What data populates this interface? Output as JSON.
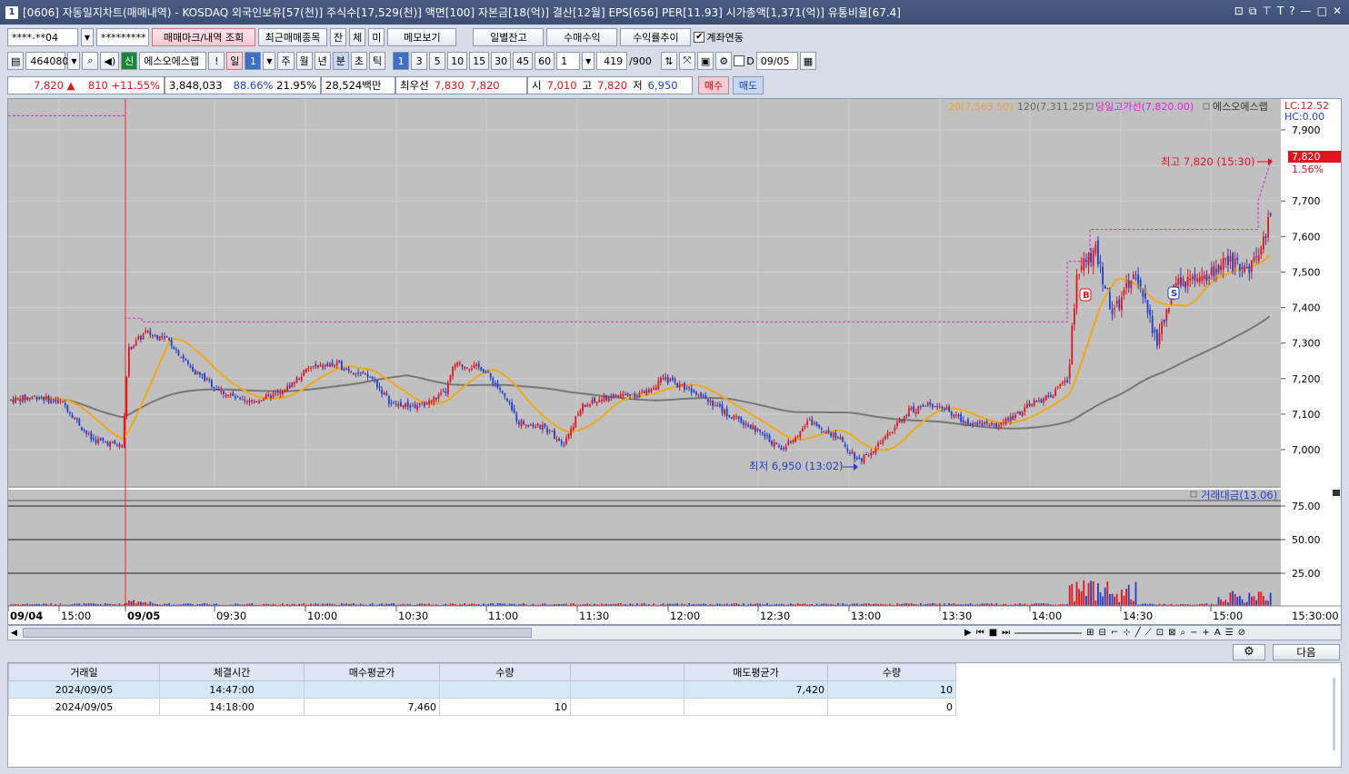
{
  "window": {
    "title": "[0606] 자동일지차트(매매내역) - KOSDAQ 외국인보유[57(천)] 주식수[17,529(천)] 액면[100] 자본금[18(억)] 결산[12월] EPS[656] PER[11.93] 시가총액[1,371(억)] 유통비율[67.4]",
    "app_num": "1"
  },
  "toolbar1": {
    "account": "****-**04",
    "password": "*********",
    "btn_mark": "매매마크/내역 조회",
    "btn_recent": "최근매매종목",
    "btn_jan": "잔",
    "btn_che": "체",
    "btn_mi": "미",
    "btn_memo": "메모보기",
    "btn_daily": "일별잔고",
    "btn_profit": "수매수익",
    "btn_rate": "수익률추이",
    "link_label": "계좌연동"
  },
  "toolbar2": {
    "code": "464080",
    "new_badge": "신",
    "stock_name": "에스오에스랩",
    "exclaim": "!",
    "periods": [
      "일",
      "1",
      "주",
      "월",
      "년",
      "분",
      "초",
      "틱"
    ],
    "minutes": [
      "1",
      "3",
      "5",
      "10",
      "15",
      "30",
      "45",
      "60"
    ],
    "count": "1",
    "range": "419",
    "range_total": "/900",
    "d_label": "D",
    "date": "09/05"
  },
  "quote": {
    "price": "7,820",
    "arrow": "▲",
    "change": "810",
    "change_pct": "+11.55%",
    "volume": "3,848,033",
    "rate1": "88.66%",
    "rate2": "21.95%",
    "amount": "28,524백만",
    "best_label": "최우선",
    "best_ask": "7,830",
    "best_bid": "7,820",
    "open_label": "시",
    "open": "7,010",
    "high_label": "고",
    "high": "7,820",
    "low_label": "저",
    "low": "6,950",
    "buy_btn": "매수",
    "sell_btn": "매도"
  },
  "chart_labels": {
    "ma20": "20(7,563.50)",
    "ma120": "120(7,311.25)",
    "dayhigh": "당일고가선(7,820.00)",
    "name": "에스오에스랩",
    "lc": "LC:12.52",
    "hc": "HC:0.00",
    "high_note": "최고 7,820 (15:30)",
    "low_note": "최저 6,950 (13:02)",
    "price_tag": "7,820",
    "pct_tag": "1.56%",
    "volume_legend": "거래대금(13.06)",
    "last_time": "15:30:00",
    "marker_b": "B",
    "marker_s": "S"
  },
  "price_axis": [
    "7,900",
    "7,700",
    "7,600",
    "7,500",
    "7,400",
    "7,300",
    "7,200",
    "7,100",
    "7,000"
  ],
  "volume_axis": [
    "75.00",
    "50.00",
    "25.00"
  ],
  "time_axis": [
    "09/04",
    "15:00",
    "09/05",
    "09:30",
    "10:00",
    "10:30",
    "11:00",
    "11:30",
    "12:00",
    "12:30",
    "13:00",
    "13:30",
    "14:00",
    "14:30",
    "15:00"
  ],
  "bottom": {
    "next_btn": "다음"
  },
  "trades": {
    "headers": [
      "거래일",
      "체결시간",
      "매수평균가",
      "수량",
      "",
      "매도평균가",
      "수량"
    ],
    "rows": [
      [
        "2024/09/05",
        "14:47:00",
        "",
        "",
        "",
        "7,420",
        "10"
      ],
      [
        "2024/09/05",
        "14:18:00",
        "7,460",
        "10",
        "",
        "",
        "0"
      ]
    ]
  },
  "colors": {
    "up": "#e0141e",
    "down": "#1f3fd0",
    "ma20": "#f0a818",
    "ma120": "#777777",
    "dayhigh": "#e020e0",
    "chart_bg": "#c0c0c0"
  }
}
